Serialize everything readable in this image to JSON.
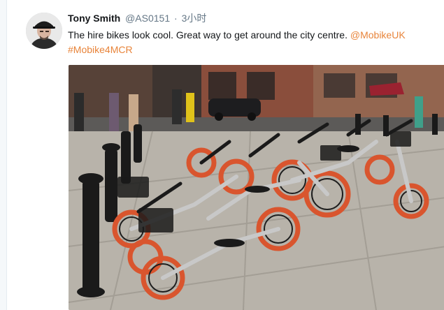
{
  "tweet": {
    "author_name": "Tony Smith",
    "handle": "@AS0151",
    "separator": "·",
    "time": "3小时",
    "text": "The hire bikes look cool. Great way to get around the city centre.",
    "mention": "@MobikeUK",
    "hashtag": "#Mobike4MCR",
    "avatar_icon": "user-avatar",
    "media_description": "Rows of orange-wheeled hire bikes parked on a city pavement with bollards",
    "colors": {
      "link": "#e8843a",
      "name": "#14171a",
      "meta": "#657786"
    }
  }
}
